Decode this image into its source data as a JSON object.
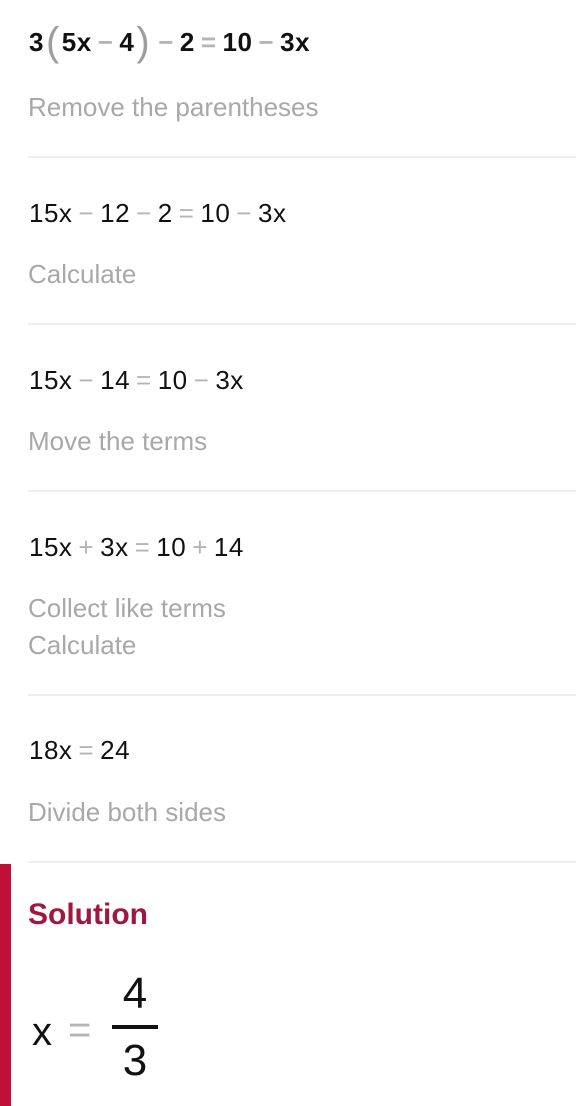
{
  "steps": [
    {
      "equation": {
        "t1": "3",
        "lp": "(",
        "t2": "5x",
        "op1": "−",
        "t3": "4",
        "rp": ")",
        "op2": "−",
        "t4": "2",
        "eq": "=",
        "t5": "10",
        "op3": "−",
        "t6": "3x"
      },
      "labels": [
        "Remove the parentheses"
      ]
    },
    {
      "equation": {
        "t1": "15x",
        "op1": "−",
        "t2": "12",
        "op2": "−",
        "t3": "2",
        "eq": "=",
        "t4": "10",
        "op3": "−",
        "t5": "3x"
      },
      "labels": [
        "Calculate"
      ]
    },
    {
      "equation": {
        "t1": "15x",
        "op1": "−",
        "t2": "14",
        "eq": "=",
        "t3": "10",
        "op2": "−",
        "t4": "3x"
      },
      "labels": [
        "Move the terms"
      ]
    },
    {
      "equation": {
        "t1": "15x",
        "op1": "+",
        "t2": "3x",
        "eq": "=",
        "t3": "10",
        "op2": "+",
        "t4": "14"
      },
      "labels": [
        "Collect like terms",
        "Calculate"
      ]
    },
    {
      "equation": {
        "t1": "18x",
        "eq": "=",
        "t2": "24"
      },
      "labels": [
        "Divide both sides"
      ]
    }
  ],
  "solution": {
    "title": "Solution",
    "variable": "x",
    "eq": "=",
    "numerator": "4",
    "denominator": "3",
    "accent_color": "#c0103a"
  }
}
